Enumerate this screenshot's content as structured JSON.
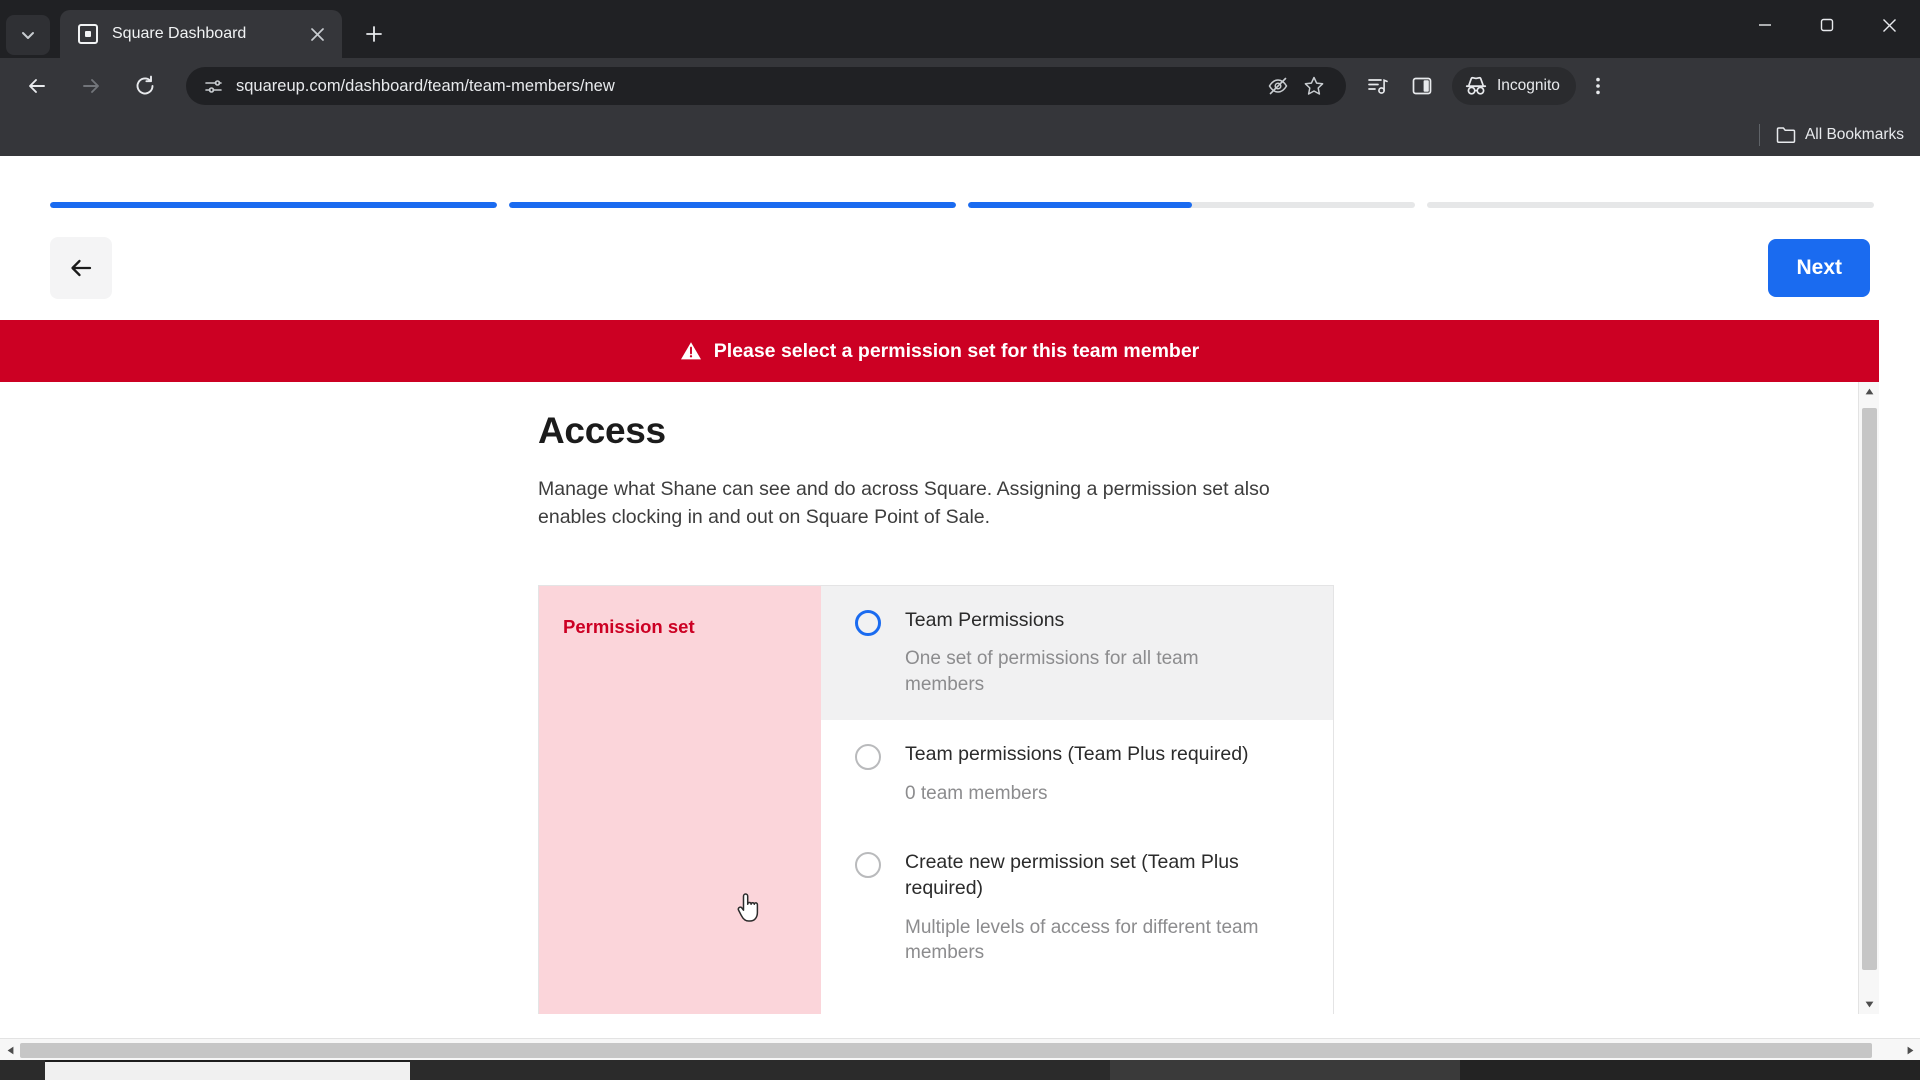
{
  "browser": {
    "tab": {
      "title": "Square Dashboard",
      "favicon_icon": "square-logo-icon",
      "close_icon": "close-icon"
    },
    "tab_search_icon": "chevron-down-icon",
    "new_tab_label": "+",
    "window_controls": {
      "minimize": "minimize-icon",
      "maximize": "maximize-icon",
      "close": "close-icon"
    },
    "nav": {
      "back_icon": "arrow-left-icon",
      "forward_icon": "arrow-right-icon",
      "reload_icon": "reload-icon"
    },
    "omnibox": {
      "site_info_icon": "page-info-icon",
      "url": "squareup.com/dashboard/team/team-members/new",
      "tracking_protection_icon": "eye-off-icon",
      "bookmark_icon": "star-icon"
    },
    "toolbar_icons": [
      {
        "name": "reading-list-icon"
      },
      {
        "name": "side-panel-icon"
      }
    ],
    "incognito": {
      "label": "Incognito",
      "icon": "incognito-hat-icon"
    },
    "menu_icon": "three-dot-menu-icon",
    "bookmarks_bar": {
      "all_bookmarks_label": "All Bookmarks",
      "folder_icon": "folder-icon"
    }
  },
  "page": {
    "progress": {
      "accent": "#1a6bf0",
      "track": "#e6e7e8",
      "segments": [
        100,
        100,
        50,
        0
      ]
    },
    "back_button": {
      "name": "back-button",
      "icon": "arrow-left-icon"
    },
    "next_button": {
      "label": "Next",
      "color": "#1a6bf0"
    },
    "error_banner": {
      "message": "Please select a permission set for this team member",
      "icon": "warning-triangle-icon",
      "background": "#cc0023"
    },
    "access": {
      "title": "Access",
      "description": "Manage what Shane can see and do across Square. Assigning a permission set also enables clocking in and out on Square Point of Sale."
    },
    "permission_card": {
      "section_label": "Permission set",
      "section_label_color": "#cc0023",
      "section_background": "#fbd5da",
      "options": [
        {
          "label": "Team Permissions",
          "sublabel": "One set of permissions for all team members",
          "selected": false,
          "hovered": true
        },
        {
          "label": "Team permissions (Team Plus required)",
          "sublabel": "0 team members",
          "selected": false,
          "hovered": false
        },
        {
          "label": "Create new permission set (Team Plus required)",
          "sublabel": "Multiple levels of access for different team members",
          "selected": false,
          "hovered": false
        }
      ]
    }
  }
}
